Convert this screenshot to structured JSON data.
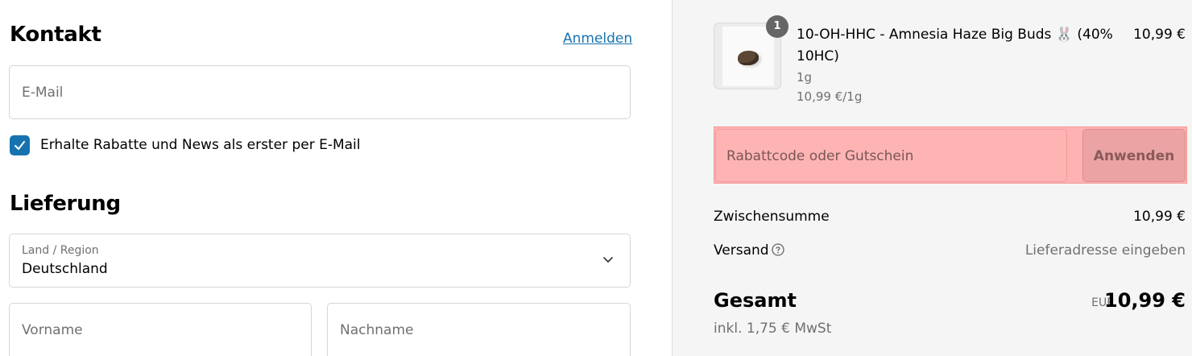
{
  "contact": {
    "heading": "Kontakt",
    "login_link": "Anmelden",
    "email_placeholder": "E-Mail",
    "newsletter_label": "Erhalte Rabatte und News als erster per E-Mail",
    "newsletter_checked": true
  },
  "delivery": {
    "heading": "Lieferung",
    "country_label": "Land / Region",
    "country_value": "Deutschland",
    "first_name_placeholder": "Vorname",
    "last_name_placeholder": "Nachname"
  },
  "cart": {
    "item": {
      "quantity": "1",
      "title": "10-OH-HHC - Amnesia Haze Big Buds 🐰 (40% 10HC)",
      "variant": "1g",
      "unit_price": "10,99 €/1g",
      "price": "10,99 €"
    },
    "coupon": {
      "placeholder": "Rabattcode oder Gutschein",
      "button_label": "Anwenden"
    },
    "subtotal_label": "Zwischensumme",
    "subtotal_value": "10,99 €",
    "shipping_label": "Versand",
    "shipping_value": "Lieferadresse eingeben",
    "total_label": "Gesamt",
    "total_currency": "EUR",
    "total_value": "10,99 €",
    "tax_note": "inkl. 1,75 € MwSt"
  },
  "colors": {
    "accent": "#1773b0",
    "summary_bg": "#f5f5f5",
    "highlight": "#ffb2b2"
  },
  "icons": [
    "checkbox-check-icon",
    "chevron-down-icon",
    "help-circle-icon",
    "rabbit-emoji"
  ]
}
